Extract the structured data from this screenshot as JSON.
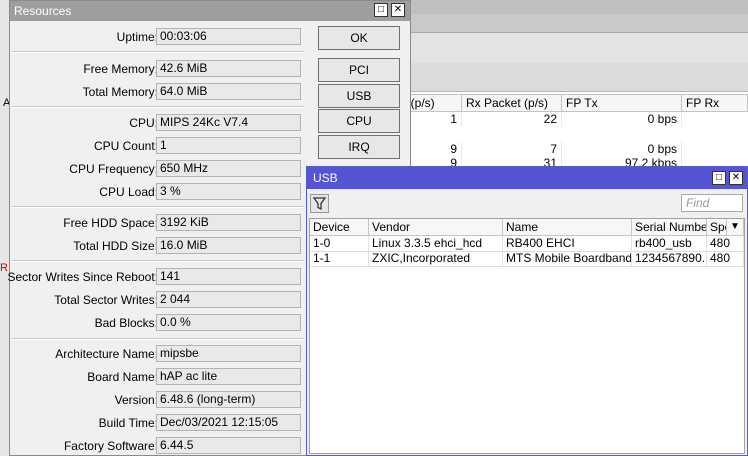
{
  "background_table": {
    "headers": [
      "t (p/s)",
      "Rx Packet (p/s)",
      "FP Tx",
      "FP Rx"
    ],
    "rows": [
      [
        "1",
        "22",
        "0 bps",
        ""
      ],
      [
        "9",
        "7",
        "0 bps",
        ""
      ],
      [
        "9",
        "31",
        "97.2 kbps",
        ""
      ]
    ],
    "left_letter_a": "A",
    "left_letter_r": "R"
  },
  "resources": {
    "title": "Resources",
    "fields": [
      {
        "label": "Uptime:",
        "value": "00:03:06"
      },
      {
        "label": "Free Memory:",
        "value": "42.6 MiB"
      },
      {
        "label": "Total Memory:",
        "value": "64.0 MiB"
      },
      {
        "label": "CPU:",
        "value": "MIPS 24Kc V7.4"
      },
      {
        "label": "CPU Count:",
        "value": "1"
      },
      {
        "label": "CPU Frequency:",
        "value": "650 MHz"
      },
      {
        "label": "CPU Load:",
        "value": "3 %"
      },
      {
        "label": "Free HDD Space:",
        "value": "3192 KiB"
      },
      {
        "label": "Total HDD Size:",
        "value": "16.0 MiB"
      },
      {
        "label": "Sector Writes Since Reboot:",
        "value": "141"
      },
      {
        "label": "Total Sector Writes:",
        "value": "2 044"
      },
      {
        "label": "Bad Blocks:",
        "value": "0.0 %"
      },
      {
        "label": "Architecture Name:",
        "value": "mipsbe"
      },
      {
        "label": "Board Name:",
        "value": "hAP ac lite"
      },
      {
        "label": "Version:",
        "value": "6.48.6 (long-term)"
      },
      {
        "label": "Build Time:",
        "value": "Dec/03/2021 12:15:05"
      },
      {
        "label": "Factory Software:",
        "value": "6.44.5"
      }
    ],
    "buttons": {
      "ok": "OK",
      "pci": "PCI",
      "usb": "USB",
      "cpu": "CPU",
      "irq": "IRQ"
    },
    "restore_glyph": "□",
    "close_glyph": "✕"
  },
  "usb": {
    "title": "USB",
    "find_placeholder": "Find",
    "columns": [
      "Device",
      "Vendor",
      "Name",
      "Serial Number",
      "Spe"
    ],
    "rows": [
      [
        "1-0",
        "Linux 3.3.5 ehci_hcd",
        "RB400 EHCI",
        "rb400_usb",
        "480"
      ],
      [
        "1-1",
        "ZXIC,Incorporated",
        "MTS Mobile Boardband",
        "1234567890...",
        "480"
      ]
    ],
    "restore_glyph": "□",
    "close_glyph": "✕",
    "sort_glyph": "▼"
  },
  "colors": {
    "usb_title": "#5555d3",
    "resources_title": "#9e9e9e"
  }
}
